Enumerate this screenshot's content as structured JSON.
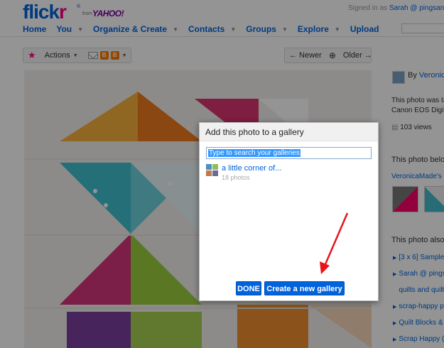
{
  "header": {
    "logo_flic": "flick",
    "logo_r": "r",
    "logo_from": "from",
    "logo_yahoo": "YAHOO!",
    "signed_in_prefix": "Signed in as",
    "signed_in_user": "Sarah @ pingsandne"
  },
  "nav": [
    {
      "label": "Home",
      "dropdown": false
    },
    {
      "label": "You",
      "dropdown": true
    },
    {
      "label": "Organize & Create",
      "dropdown": true
    },
    {
      "label": "Contacts",
      "dropdown": true
    },
    {
      "label": "Groups",
      "dropdown": true
    },
    {
      "label": "Explore",
      "dropdown": true
    },
    {
      "label": "Upload",
      "dropdown": false
    }
  ],
  "toolbar": {
    "actions_label": "Actions",
    "newer_label": "← Newer",
    "older_label": "Older →"
  },
  "sidebar": {
    "by_prefix": "By",
    "owner": "Veronic",
    "photo_was_taken": "This photo was ta",
    "camera": "Canon EOS Digita",
    "views": "103 views",
    "belongs_heading": "This photo belo",
    "set_link": "VeronicaMade's",
    "also_heading": "This photo also",
    "also_items": [
      "[3 x 6] Sample",
      "Sarah @ pings",
      "quilts and quilt",
      "scrap-happy p",
      "Quilt Blocks &",
      "Scrap Happy ("
    ]
  },
  "dialog": {
    "title": "Add this photo to a gallery",
    "search_value": "Type to search your galleries",
    "gallery_name": "a little corner of...",
    "gallery_count": "18 photos",
    "done_label": "DONE",
    "create_label": "Create a new gallery"
  },
  "colors": {
    "flickr_blue": "#0063dc",
    "flickr_pink": "#ff0084",
    "annotation_red": "#e8141b"
  }
}
